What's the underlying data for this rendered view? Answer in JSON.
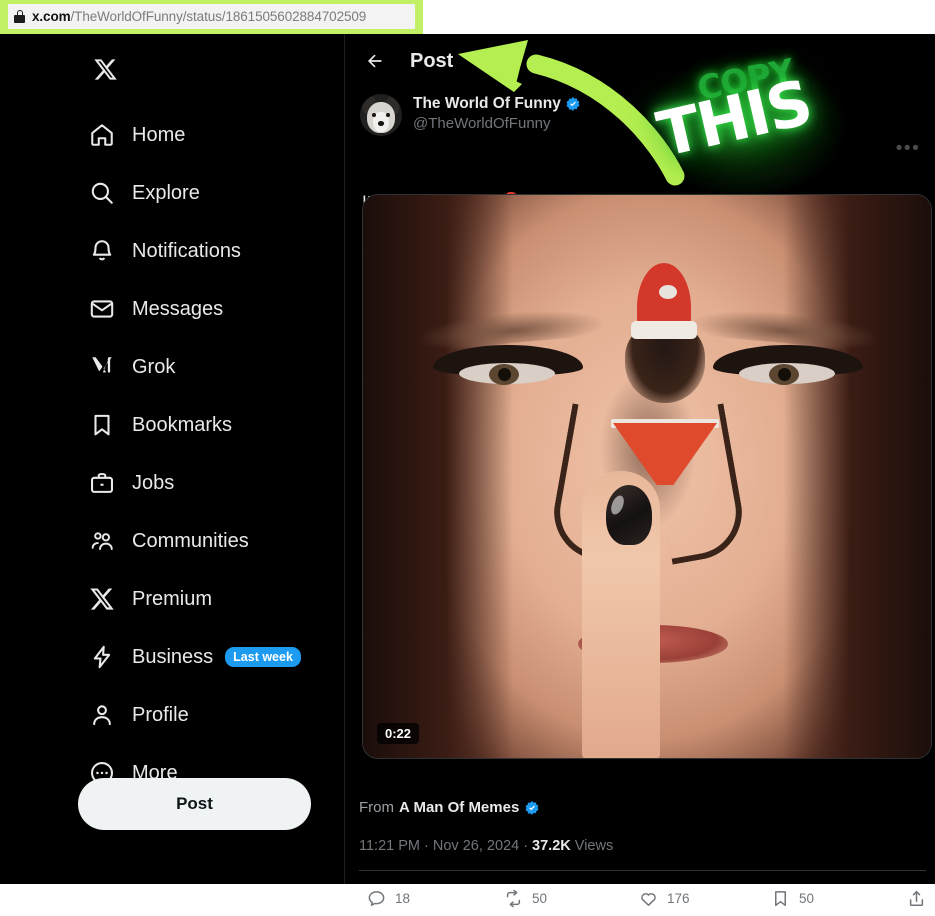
{
  "browser": {
    "url_domain": "x.com",
    "url_path": "/TheWorldOfFunny/status/1861505602884702509",
    "lock_icon": "lock-icon",
    "highlight_color": "#c3f165"
  },
  "sidebar": {
    "logo": "x-logo",
    "items": [
      {
        "label": "Home",
        "icon": "home-icon"
      },
      {
        "label": "Explore",
        "icon": "search-icon"
      },
      {
        "label": "Notifications",
        "icon": "bell-icon"
      },
      {
        "label": "Messages",
        "icon": "envelope-icon"
      },
      {
        "label": "Grok",
        "icon": "grok-icon"
      },
      {
        "label": "Bookmarks",
        "icon": "bookmark-icon"
      },
      {
        "label": "Jobs",
        "icon": "briefcase-icon"
      },
      {
        "label": "Communities",
        "icon": "communities-icon"
      },
      {
        "label": "Premium",
        "icon": "x-icon"
      },
      {
        "label": "Business",
        "icon": "lightning-icon",
        "badge": "Last week"
      },
      {
        "label": "Profile",
        "icon": "person-icon"
      },
      {
        "label": "More",
        "icon": "more-circle-icon"
      }
    ],
    "post_button": "Post"
  },
  "header": {
    "title": "Post",
    "back_icon": "back-arrow-icon",
    "more_icon": "more-horizontal-icon"
  },
  "post": {
    "author_name": "The World Of Funny",
    "author_handle": "@TheWorldOfFunny",
    "verified_icon": "verified-badge-icon",
    "text": "Its that time again 🎅",
    "video": {
      "duration": "0:22"
    },
    "from_prefix": "From",
    "from_name": "A Man Of Memes",
    "timestamp_time": "11:21 PM",
    "timestamp_date": "Nov 26, 2024",
    "views_count": "37.2K",
    "views_label": "Views",
    "actions": {
      "reply": {
        "count": "18",
        "icon": "reply-icon"
      },
      "repost": {
        "count": "50",
        "icon": "repost-icon"
      },
      "like": {
        "count": "176",
        "icon": "heart-icon"
      },
      "bookmark": {
        "count": "50",
        "icon": "bookmark-icon"
      },
      "share": {
        "icon": "share-icon"
      }
    }
  },
  "annotations": {
    "arrow": {
      "name": "green-arrow-annotation",
      "color": "#b4ee50"
    },
    "copy_word": "COPY",
    "this_word": "THIS",
    "copy_color": "#22a839",
    "this_color": "#ffffff"
  },
  "colors": {
    "accent_blue": "#1d9bf0",
    "background": "#000000",
    "text_primary": "#e7e9ea",
    "text_secondary": "#71767b"
  }
}
